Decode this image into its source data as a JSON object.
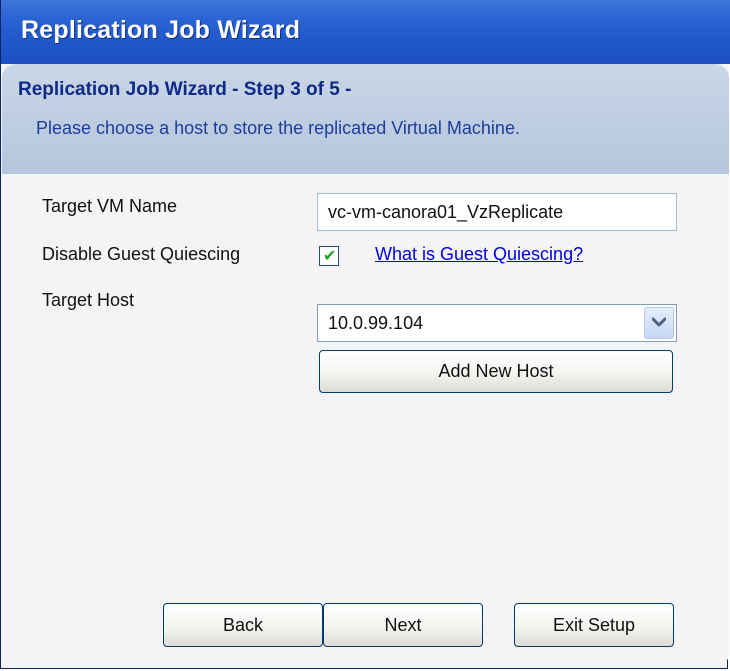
{
  "window": {
    "title": "Replication Job Wizard"
  },
  "header": {
    "step_title": "Replication Job Wizard - Step 3 of 5 -",
    "step_description": "Please choose a host to store the replicated Virtual Machine."
  },
  "form": {
    "target_vm_name_label": "Target VM Name",
    "target_vm_name_value": "vc-vm-canora01_VzReplicate",
    "disable_guest_quiescing_label": "Disable Guest Quiescing",
    "disable_guest_quiescing_checked": true,
    "guest_quiescing_link": "What is Guest Quiescing?",
    "target_host_label": "Target Host",
    "target_host_value": "10.0.99.104",
    "add_new_host_label": "Add New Host"
  },
  "footer": {
    "back_label": "Back",
    "next_label": "Next",
    "exit_label": "Exit Setup"
  },
  "icons": {
    "checkmark": "check-icon",
    "dropdown": "chevron-down-icon"
  }
}
